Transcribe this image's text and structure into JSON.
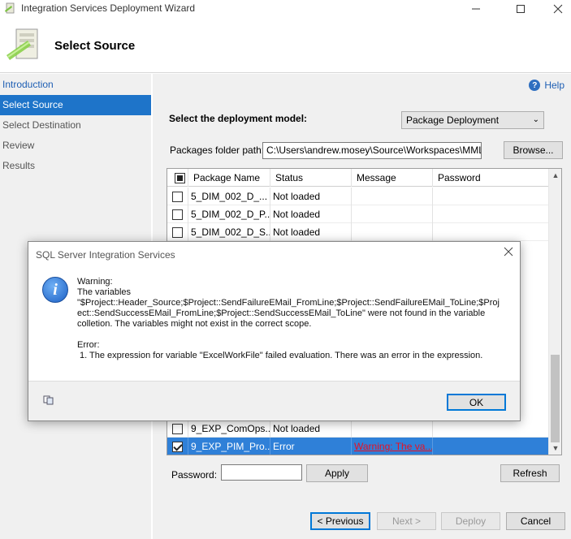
{
  "window": {
    "title": "Integration Services Deployment Wizard"
  },
  "header": {
    "page_title": "Select Source"
  },
  "nav": {
    "items": [
      {
        "label": "Introduction",
        "state": "link"
      },
      {
        "label": "Select Source",
        "state": "selected"
      },
      {
        "label": "Select Destination",
        "state": "normal"
      },
      {
        "label": "Review",
        "state": "normal"
      },
      {
        "label": "Results",
        "state": "normal"
      }
    ]
  },
  "main": {
    "help_label": "Help",
    "model_label": "Select the deployment model:",
    "model_value": "Package Deployment",
    "path_label": "Packages folder path:",
    "path_value": "C:\\Users\\andrew.mosey\\Source\\Workspaces\\MML BI",
    "browse_label": "Browse...",
    "password_label": "Password:",
    "apply_label": "Apply",
    "refresh_label": "Refresh"
  },
  "grid": {
    "columns": [
      "Package Name",
      "Status",
      "Message",
      "Password"
    ],
    "rows": [
      {
        "checked": false,
        "name": "5_DIM_002_D_...",
        "status": "Not loaded",
        "message": "",
        "password": ""
      },
      {
        "checked": false,
        "name": "5_DIM_002_D_P...",
        "status": "Not loaded",
        "message": "",
        "password": ""
      },
      {
        "checked": false,
        "name": "5_DIM_002_D_S...",
        "status": "Not loaded",
        "message": "",
        "password": ""
      },
      {
        "checked": false,
        "name": "9_EXP_ComOps...",
        "status": "Not loaded",
        "message": "",
        "password": ""
      },
      {
        "checked": true,
        "name": "9_EXP_PIM_Pro...",
        "status": "Error",
        "message": "Warning: The va...",
        "password": ""
      }
    ]
  },
  "footer": {
    "previous_label": "< Previous",
    "next_label": "Next >",
    "deploy_label": "Deploy",
    "cancel_label": "Cancel"
  },
  "dialog": {
    "title": "SQL Server Integration Services",
    "warning_heading": "Warning:",
    "warning_line1": "The variables",
    "warning_line2": "\"$Project::Header_Source;$Project::SendFailureEMail_FromLine;$Project::SendFailureEMail_ToLine;$Proj",
    "warning_line3": "ect::SendSuccessEMail_FromLine;$Project::SendSuccessEMail_ToLine\" were not found in the variable",
    "warning_line4": "colletion. The variables might not exist in the correct scope.",
    "error_heading": "Error:",
    "error_line1": "1. The expression for variable \"ExcelWorkFile\" failed evaluation. There was an error in the expression.",
    "ok_label": "OK"
  }
}
